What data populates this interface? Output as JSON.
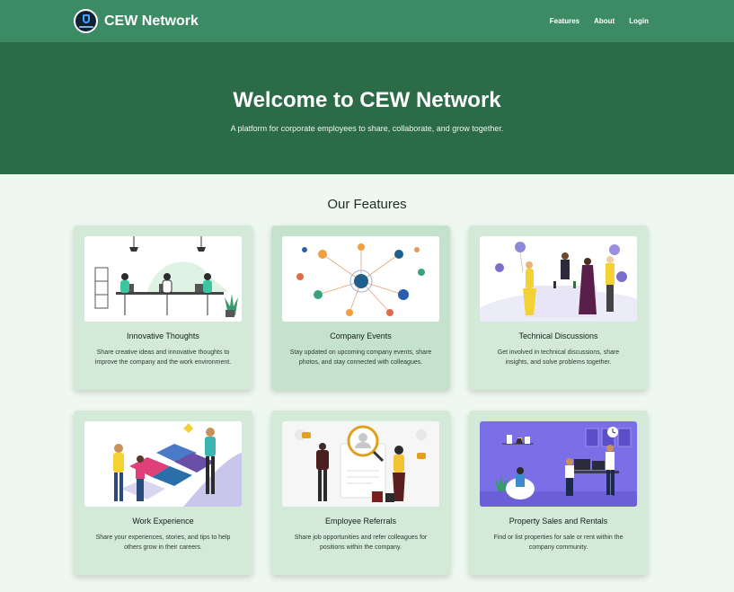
{
  "navbar": {
    "brand": "CEW Network",
    "links": [
      "Features",
      "About",
      "Login"
    ]
  },
  "hero": {
    "title": "Welcome to CEW Network",
    "subtitle": "A platform for corporate employees to share, collaborate, and grow together."
  },
  "features": {
    "heading": "Our Features",
    "cards": [
      {
        "title": "Innovative Thoughts",
        "text": "Share creative ideas and innovative thoughts to improve the company and the work environment.",
        "image": "coworking-illustration"
      },
      {
        "title": "Company Events",
        "text": "Stay updated on upcoming company events, share photos, and stay connected with colleagues.",
        "image": "network-illustration"
      },
      {
        "title": "Technical Discussions",
        "text": "Get involved in technical discussions, share insights, and solve problems together.",
        "image": "celebration-illustration"
      },
      {
        "title": "Work Experience",
        "text": "Share your experiences, stories, and tips to help others grow in their careers.",
        "image": "puzzle-team-illustration"
      },
      {
        "title": "Employee Referrals",
        "text": "Share job opportunities and refer colleagues for positions within the company.",
        "image": "referral-magnifier-illustration"
      },
      {
        "title": "Property Sales and Rentals",
        "text": "Find or list properties for sale or rent within the company community.",
        "image": "office-interior-illustration"
      }
    ]
  },
  "colors": {
    "navbar": "#3d8b64",
    "hero": "#2c6b48",
    "page_background": "#eef7f0",
    "card": "#d2ead7"
  }
}
